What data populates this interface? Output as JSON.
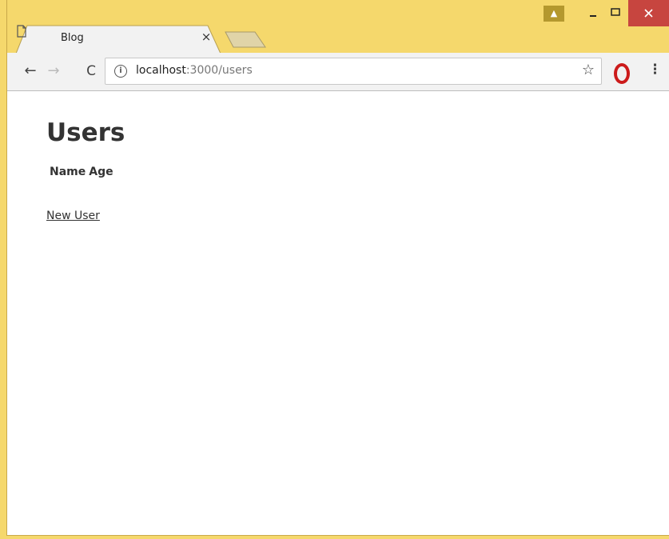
{
  "browser": {
    "tab": {
      "title": "Blog",
      "close_label": "×"
    },
    "window_controls": {
      "minimize": "–",
      "maximize": "☐",
      "close": "✕"
    },
    "address": {
      "host": "localhost",
      "rest": ":3000/users"
    },
    "icons": {
      "back": "back-arrow-icon",
      "forward": "forward-arrow-icon",
      "reload": "reload-icon",
      "info": "info-icon",
      "star": "star-icon",
      "opera": "opera-icon",
      "menu": "menu-icon",
      "profile": "profile-icon",
      "page": "page-icon"
    },
    "colors": {
      "frame": "#f5d86c",
      "close": "#c7453f",
      "opera": "#cc1b1b"
    }
  },
  "page": {
    "title": "Users",
    "table": {
      "headers": [
        "Name",
        "Age"
      ]
    },
    "new_user_link": "New User"
  }
}
